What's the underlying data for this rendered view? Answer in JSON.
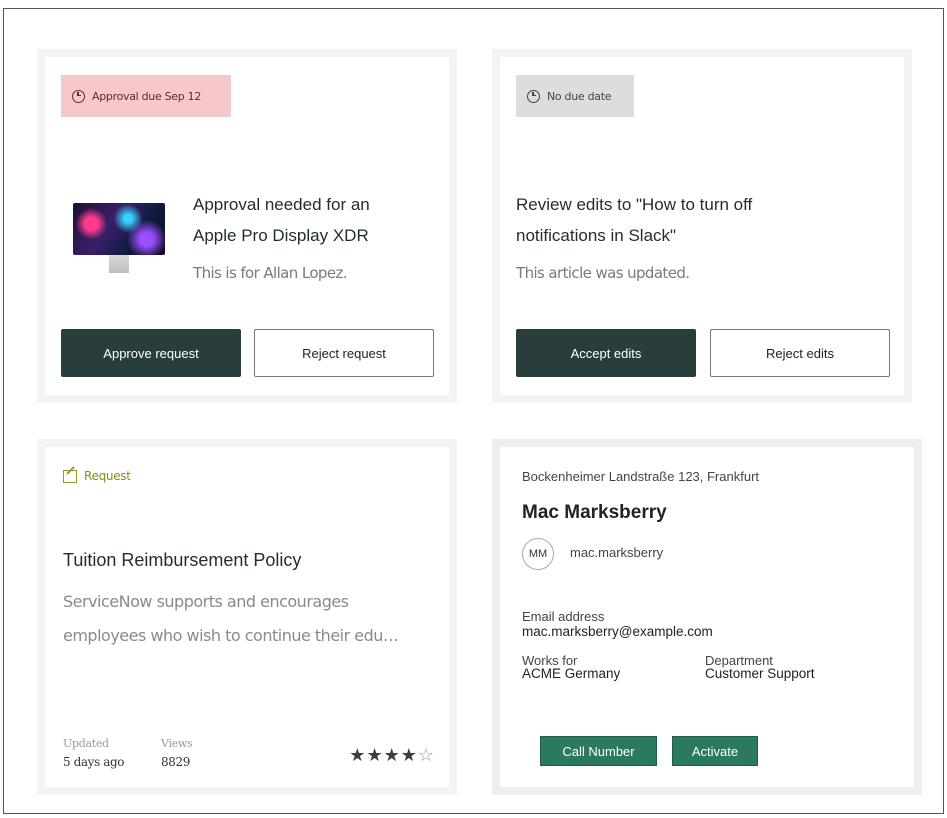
{
  "cards": {
    "approval": {
      "badge": "Approval due Sep 12",
      "title_line1": "Approval needed for an",
      "title_line2": "Apple Pro Display XDR",
      "subtitle": "This is for Allan Lopez.",
      "primary_label": "Approve request",
      "secondary_label": "Reject request"
    },
    "review": {
      "badge": "No due date",
      "title_line1": "Review edits to \"How to turn off",
      "title_line2": "notifications in Slack\"",
      "subtitle": "This article was updated.",
      "primary_label": "Accept edits",
      "secondary_label": "Reject edits"
    },
    "article": {
      "tag": "Request",
      "title": "Tuition Reimbursement Policy",
      "desc_line1": "ServiceNow supports and encourages",
      "desc_line2": "employees who wish to continue their edu…",
      "updated_label": "Updated",
      "updated_value": "5 days ago",
      "views_label": "Views",
      "views_value": "8829",
      "rating": 4,
      "rating_max": 5
    },
    "contact": {
      "address": "Bockenheimer Landstraße 123, Frankfurt",
      "name": "Mac Marksberry",
      "initials": "MM",
      "username": "mac.marksberry",
      "email_label": "Email address",
      "email_value": "mac.marksberry@example.com",
      "works_for_label": "Works for",
      "works_for_value": "ACME Germany",
      "department_label": "Department",
      "department_value": "Customer Support",
      "call_label": "Call Number",
      "activate_label": "Activate"
    }
  },
  "colors": {
    "primary_button": "#293d3d",
    "due_badge": "#f5c9c9",
    "nodue_badge": "#dddddd",
    "request_tag": "#8b8a16",
    "green_button": "#2b7a5f"
  }
}
